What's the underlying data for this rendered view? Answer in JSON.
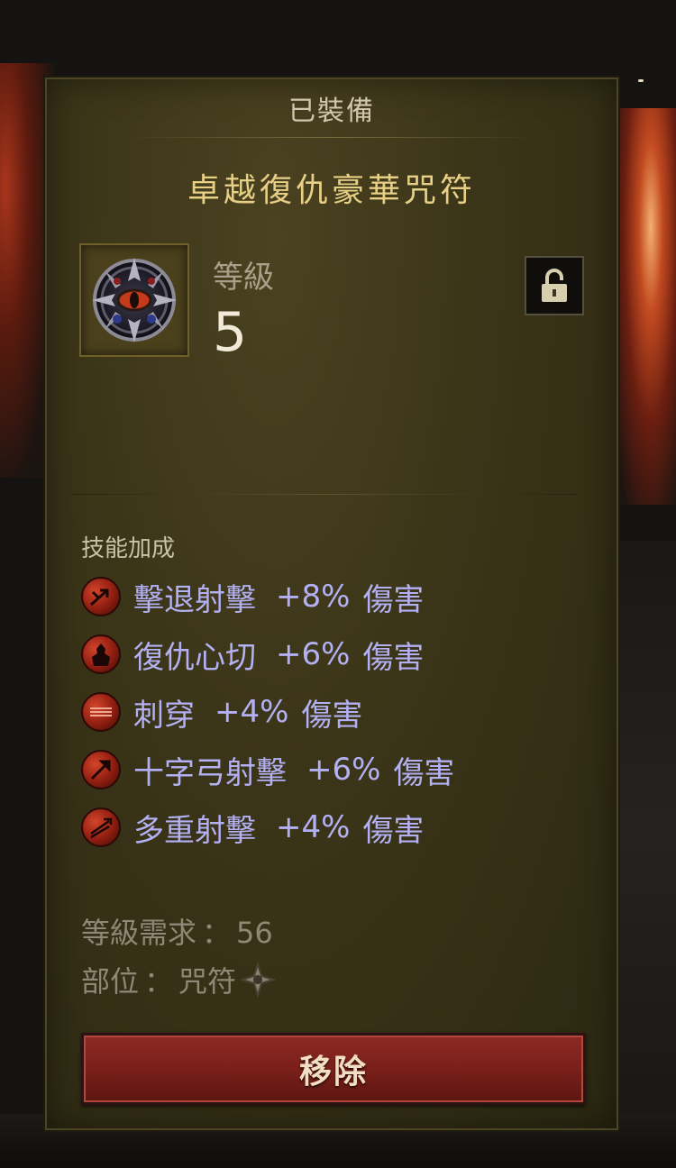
{
  "panel": {
    "header": "已裝備",
    "item_name": "卓越復仇豪華咒符",
    "level_label": "等級",
    "level_value": "5",
    "icons": {
      "item": "rune-amulet-icon",
      "lock": "lock-icon"
    }
  },
  "bonuses": {
    "heading": "技能加成",
    "items": [
      {
        "skill": "擊退射擊",
        "bonus": "+8%",
        "unit": "傷害",
        "icon": "knockback-shot-icon"
      },
      {
        "skill": "復仇心切",
        "bonus": "+6%",
        "unit": "傷害",
        "icon": "vengeance-icon"
      },
      {
        "skill": "刺穿",
        "bonus": "+4%",
        "unit": "傷害",
        "icon": "pierce-icon"
      },
      {
        "skill": "十字弓射擊",
        "bonus": "+6%",
        "unit": "傷害",
        "icon": "crossbow-shot-icon"
      },
      {
        "skill": "多重射擊",
        "bonus": "+4%",
        "unit": "傷害",
        "icon": "multishot-icon"
      }
    ]
  },
  "requirements": {
    "level_label": "等級需求",
    "level_value": "56",
    "slot_label": "部位",
    "slot_value": "咒符",
    "separator": "：",
    "slot_icon": "charm-slot-icon"
  },
  "actions": {
    "remove_label": "移除"
  },
  "colors": {
    "title": "#e7cf86",
    "skill_text": "#b3b0f4",
    "button": "#7a1f1a"
  }
}
